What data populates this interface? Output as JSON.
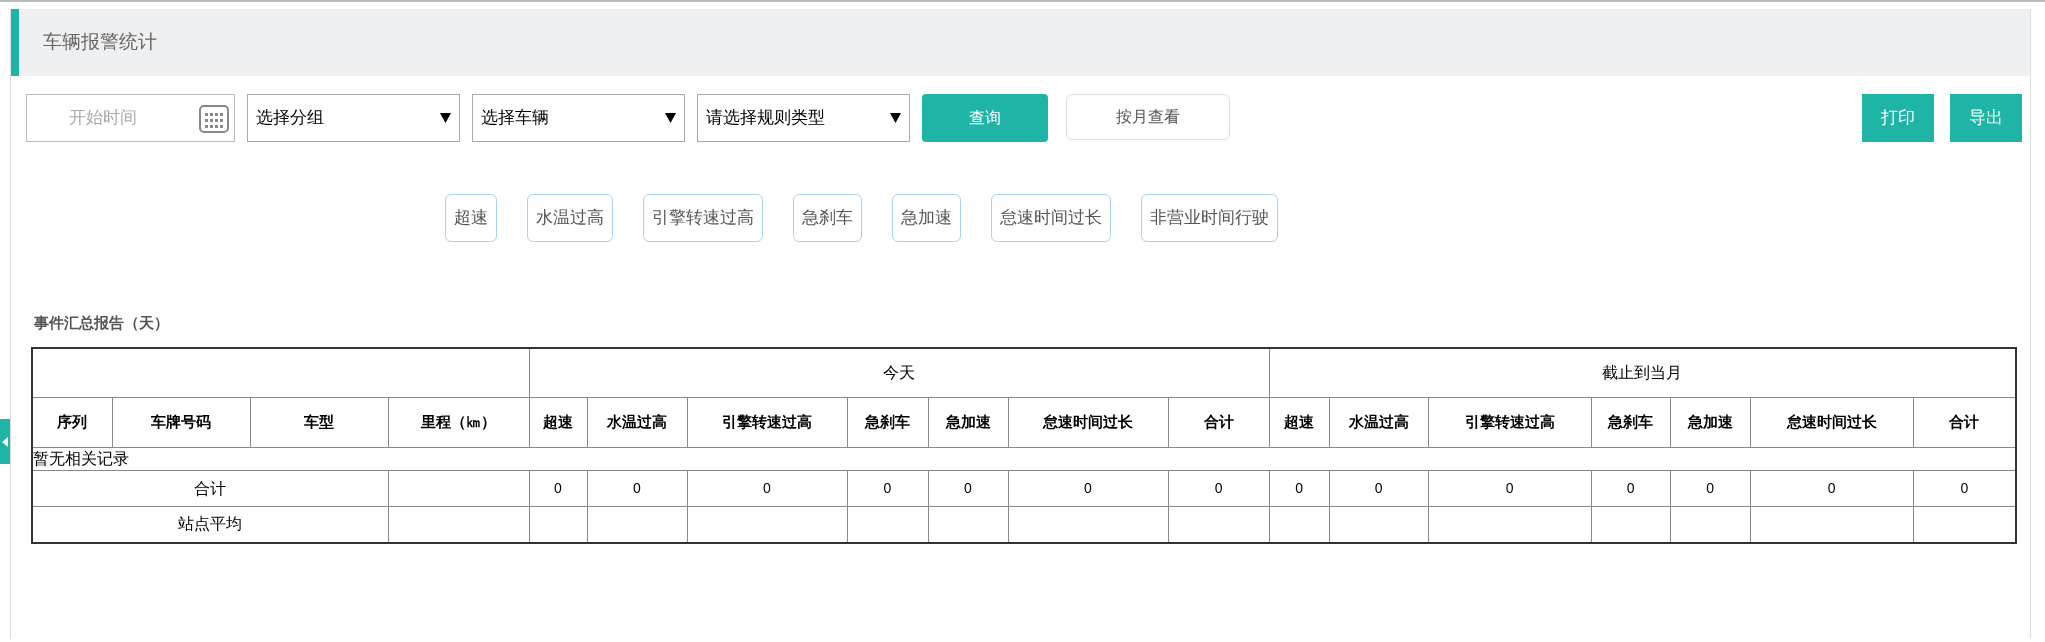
{
  "page_title": "车辆报警统计",
  "toolbar": {
    "start_time": {
      "placeholder": "开始时间"
    },
    "selects": [
      {
        "value": "选择分组"
      },
      {
        "value": "选择车辆"
      },
      {
        "value": "请选择规则类型"
      }
    ],
    "buttons": [
      {
        "label": "查询",
        "kind": "primary"
      },
      {
        "label": "按月查看",
        "kind": "outline"
      }
    ],
    "right_buttons": [
      {
        "label": "打印"
      },
      {
        "label": "导出"
      }
    ]
  },
  "rule_chips": [
    "超速",
    "水温过高",
    "引擎转速过高",
    "急刹车",
    "急加速",
    "怠速时间过长",
    "非营业时间行驶"
  ],
  "report": {
    "title": "事件汇总报告（天）",
    "groups": [
      "今天",
      "截止到当月"
    ],
    "base_columns": [
      "序列",
      "车牌号码",
      "车型",
      "里程（㎞）"
    ],
    "group_columns": [
      [
        "超速",
        "水温过高",
        "引擎转速过高",
        "急刹车",
        "急加速",
        "怠速时间过长",
        "合计"
      ],
      [
        "超速",
        "水温过高",
        "引擎转速过高",
        "急刹车",
        "急加速",
        "怠速时间过长",
        "合计"
      ]
    ],
    "empty_message": "暂无相关记录",
    "rows": [
      {
        "label": "合计",
        "values": [
          "0",
          "0",
          "0",
          "0",
          "0",
          "0",
          "0",
          "0",
          "0",
          "0",
          "0",
          "0",
          "0",
          "0"
        ]
      },
      {
        "label": "站点平均"
      }
    ]
  }
}
